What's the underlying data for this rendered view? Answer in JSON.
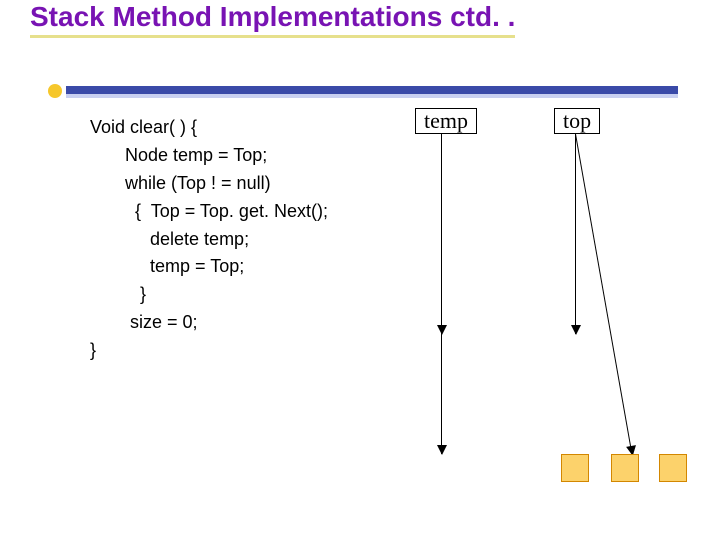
{
  "title": "Stack Method Implementations ctd. .",
  "labels": {
    "temp": "temp",
    "top": "top"
  },
  "code": "Void clear( ) {\n       Node temp = Top;\n       while (Top ! = null)\n         {  Top = Top. get. Next();\n            delete temp;\n            temp = Top;\n          }\n        size = 0;\n}",
  "chart_data": {
    "type": "diagram",
    "title": "Stack Method Implementations ctd..",
    "pointers": [
      {
        "name": "temp",
        "arrows": 2,
        "points_to": "stack region / nodes"
      },
      {
        "name": "top",
        "arrows": 2,
        "points_to": "stack region / nodes"
      }
    ],
    "nodes": 3,
    "pseudocode": [
      "Void clear( ) {",
      "    Node temp = Top;",
      "    while (Top != null) {",
      "        Top = Top.getNext();",
      "        delete temp;",
      "        temp = Top;",
      "    }",
      "    size = 0;",
      "}"
    ]
  }
}
